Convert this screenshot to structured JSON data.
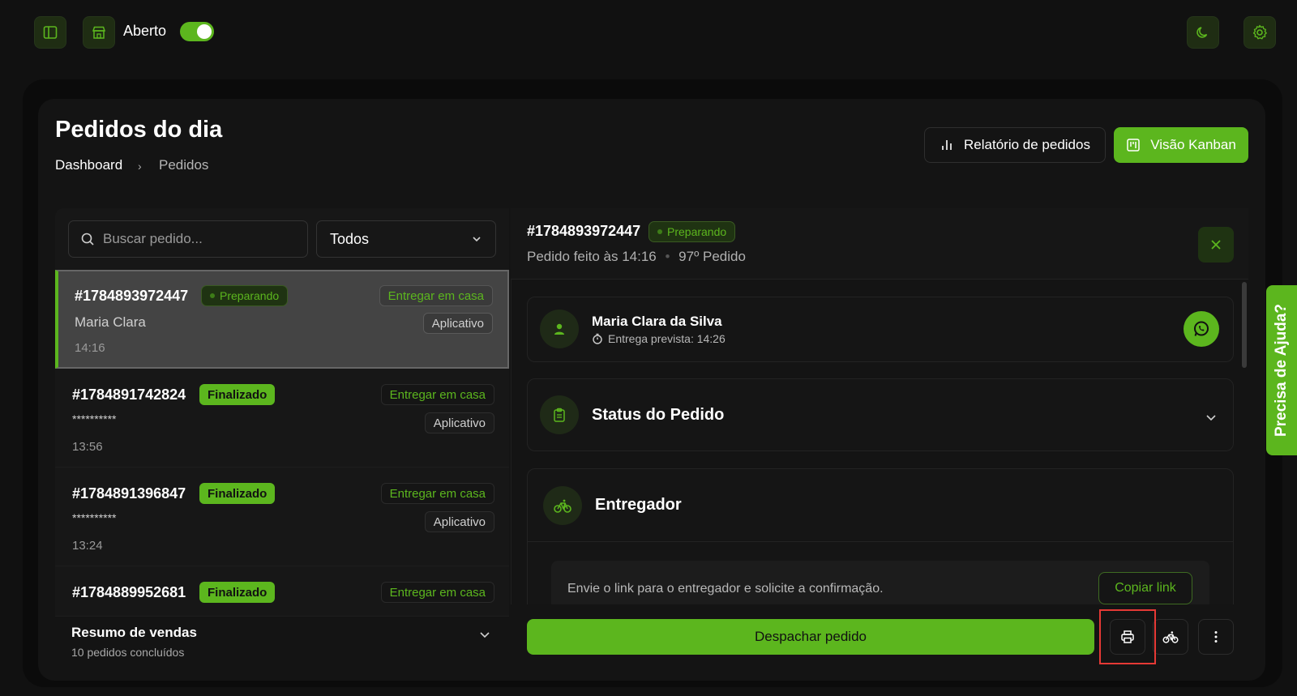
{
  "topbar": {
    "store_status_label": "Aberto",
    "store_open": true
  },
  "header": {
    "title": "Pedidos do dia",
    "breadcrumb": [
      "Dashboard",
      "Pedidos"
    ],
    "report_button": "Relatório de pedidos",
    "kanban_button": "Visão Kanban"
  },
  "filters": {
    "search_placeholder": "Buscar pedido...",
    "select_value": "Todos"
  },
  "orders": [
    {
      "id": "#1784893972447",
      "status": "Preparando",
      "customer": "Maria Clara",
      "delivery": "Entregar em casa",
      "channel": "Aplicativo",
      "time": "14:16"
    },
    {
      "id": "#1784891742824",
      "status": "Finalizado",
      "customer": "**********",
      "delivery": "Entregar em casa",
      "channel": "Aplicativo",
      "time": "13:56"
    },
    {
      "id": "#1784891396847",
      "status": "Finalizado",
      "customer": "**********",
      "delivery": "Entregar em casa",
      "channel": "Aplicativo",
      "time": "13:24"
    },
    {
      "id": "#1784889952681",
      "status": "Finalizado",
      "delivery": "Entregar em casa"
    }
  ],
  "summary": {
    "title": "Resumo de vendas",
    "subtitle": "10 pedidos concluídos"
  },
  "detail": {
    "id": "#1784893972447",
    "status": "Preparando",
    "placed_at": "Pedido feito às 14:16",
    "order_number": "97º Pedido",
    "customer_name": "Maria Clara da Silva",
    "eta": "Entrega prevista: 14:26",
    "status_section": "Status do Pedido",
    "courier_section": "Entregador",
    "courier_hint": "Envie o link para o entregador e solicite a confirmação.",
    "copy_link": "Copiar link",
    "dispatch_button": "Despachar pedido"
  },
  "help_tab": "Precisa de Ajuda?",
  "colors": {
    "accent": "#5cb61e",
    "background": "#111111",
    "highlight": "#e53935"
  }
}
